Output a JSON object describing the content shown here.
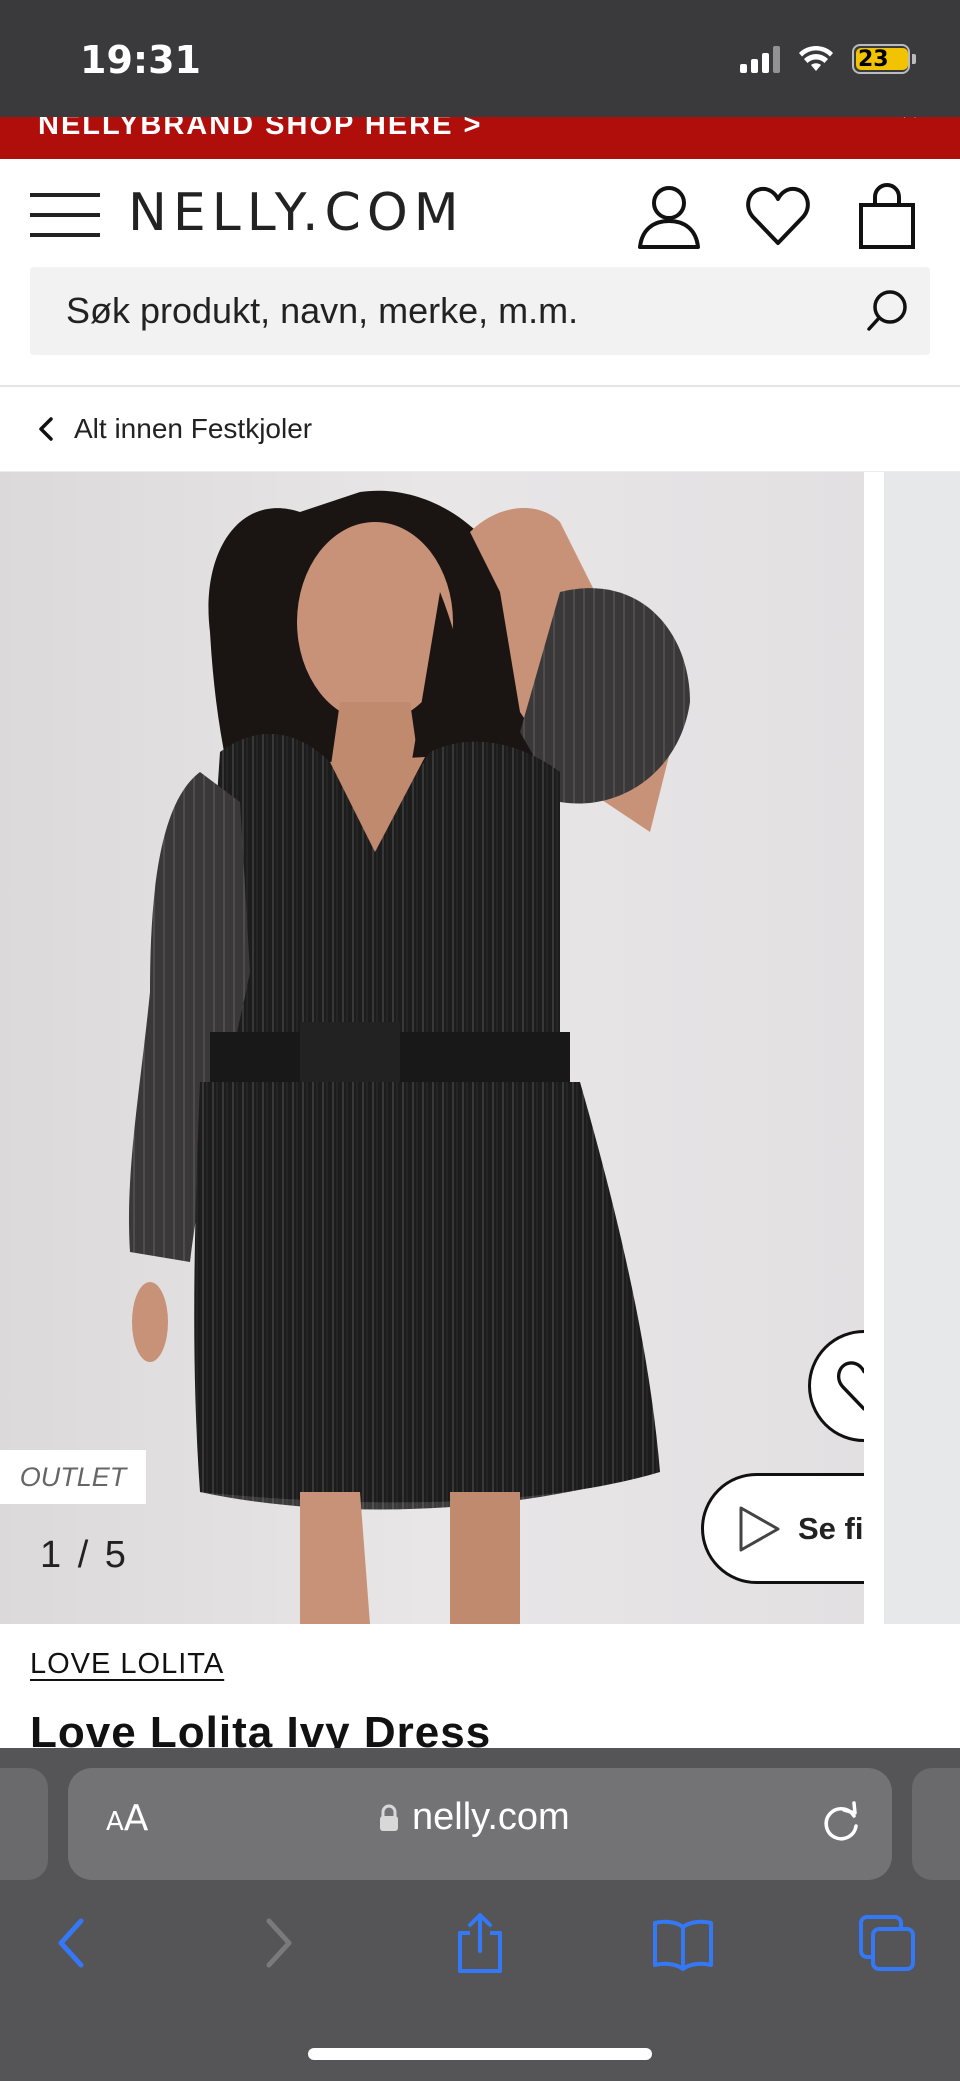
{
  "status_bar": {
    "time": "19:31",
    "battery": "23",
    "battery_level": 0.23,
    "battery_color": "#f2c300"
  },
  "promo": {
    "text": "NELLYBRAND SHOP HERE >",
    "background": "#b00e0b",
    "close_icon": "chevron-icon"
  },
  "header": {
    "logo": "NELLY.COM",
    "menu_icon": "hamburger-menu-icon",
    "account_icon": "user-icon",
    "wishlist_icon": "heart-icon",
    "cart_icon": "shopping-bag-icon"
  },
  "search": {
    "placeholder": "Søk produkt, navn, merke, m.m.",
    "icon": "search-icon"
  },
  "breadcrumb": {
    "label": "Alt innen Festkjoler",
    "icon": "chevron-left-icon"
  },
  "gallery": {
    "badge": "OUTLET",
    "counter": "1 / 5",
    "current": 1,
    "total": 5,
    "favorite_icon": "heart-icon",
    "video_label": "Se film",
    "video_icon": "play-icon"
  },
  "product": {
    "brand": "LOVE LOLITA",
    "title": "Love Lolita Ivy Dress"
  },
  "browser": {
    "text_size_small": "A",
    "text_size_large": "A",
    "url": "nelly.com",
    "lock_icon": "lock-icon",
    "reload_icon": "reload-icon",
    "toolbar": [
      "back-icon",
      "forward-icon",
      "share-icon",
      "bookmarks-icon",
      "tabs-icon"
    ],
    "accent": "#3478f6"
  }
}
